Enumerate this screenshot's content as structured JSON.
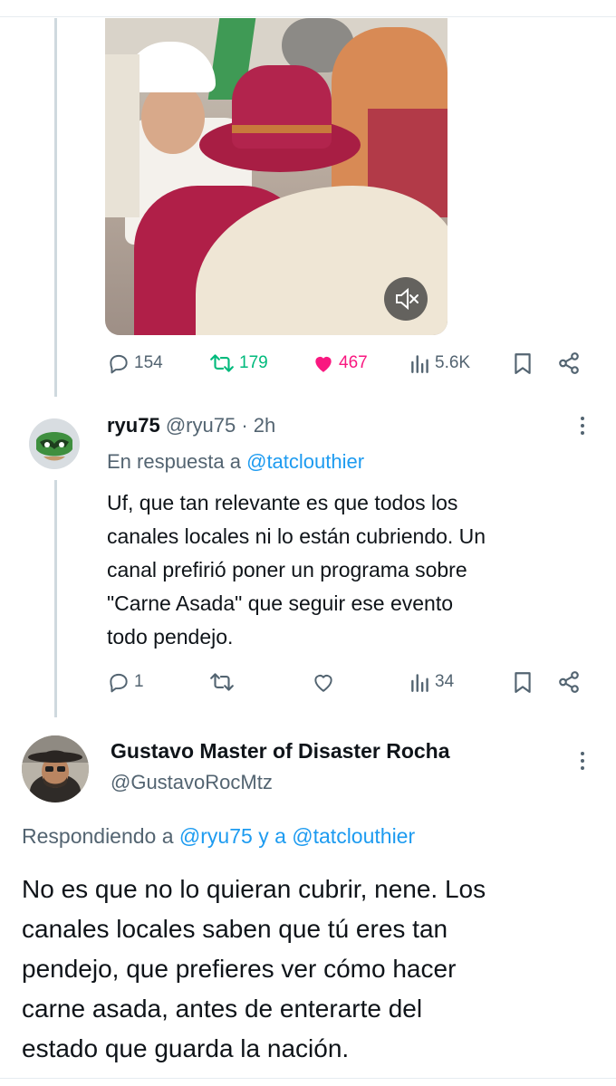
{
  "tweet1": {
    "stats": {
      "replies": "154",
      "retweets": "179",
      "likes": "467",
      "views": "5.6K"
    }
  },
  "reply1": {
    "display_name": "ryu75",
    "handle": "@ryu75",
    "separator": "·",
    "time": "2h",
    "in_reply_prefix": "En respuesta a",
    "in_reply_handle": "@tatclouthier",
    "text": "Uf, que tan relevante es que todos los\ncanales locales ni lo están cubriendo. Un\ncanal prefirió poner un programa sobre\n\"Carne Asada\" que seguir ese evento\ntodo pendejo.",
    "stats": {
      "replies": "1",
      "views": "34"
    }
  },
  "reply2": {
    "display_name": "Gustavo Master of Disaster Rocha",
    "handle": "@GustavoRocMtz",
    "replying_prefix": "Respondiendo a",
    "replying_handle_1": "@ryu75",
    "replying_joiner": "y a",
    "replying_handle_2": "@tatclouthier",
    "text": "No es que no lo quieran cubrir, nene. Los\ncanales locales saben que tú eres tan\npendejo, que prefieres ver cómo hacer\ncarne asada, antes de enterarte del\nestado que guarda la nación."
  },
  "colors": {
    "accent": "#1d9bf0",
    "muted": "#536471",
    "like": "#f91880",
    "retweet": "#00ba7c",
    "thread": "#cfd9de"
  },
  "icons": [
    "reply-icon",
    "retweet-icon",
    "like-icon",
    "views-icon",
    "bookmark-icon",
    "share-icon",
    "more-icon",
    "mute-icon"
  ]
}
